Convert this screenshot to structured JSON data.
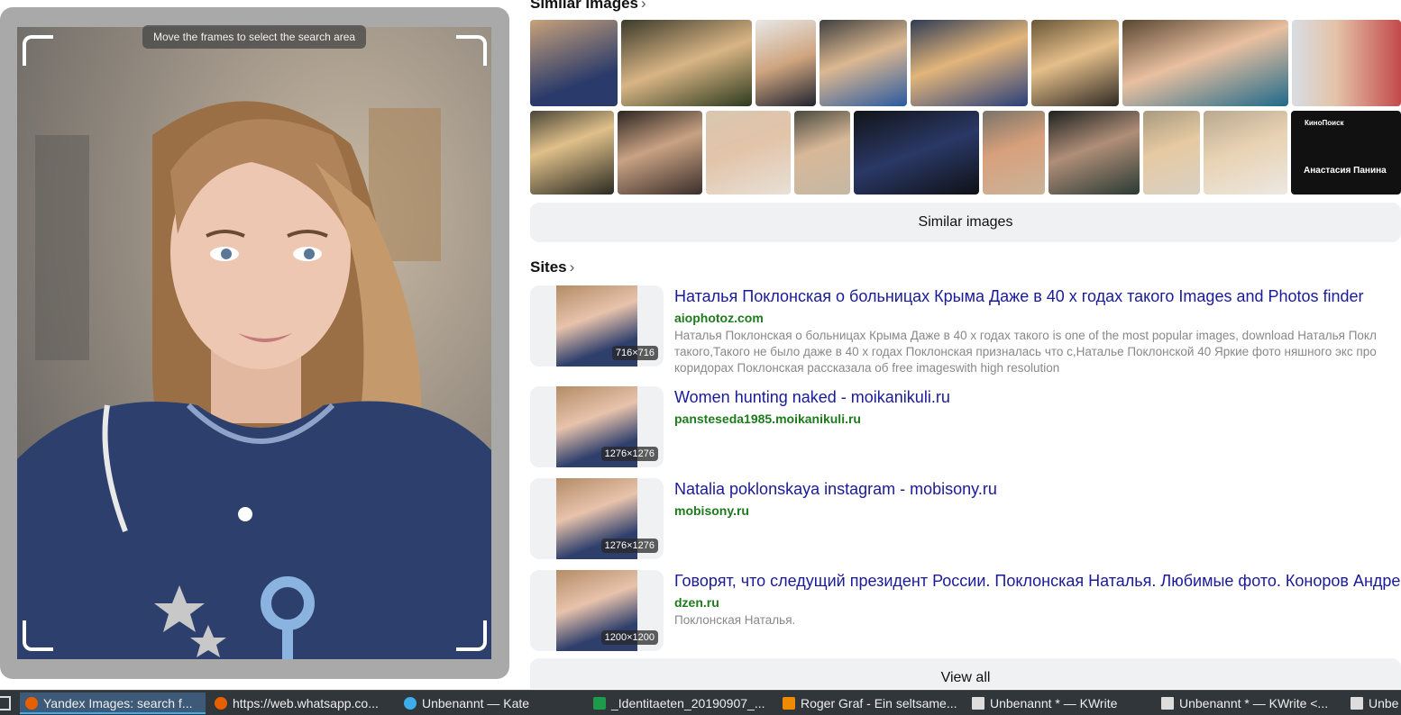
{
  "crop": {
    "hint": "Move the frames to select the search area",
    "icon_handle": "crop-handle-icon"
  },
  "similar": {
    "title": "Similar images",
    "button_label": "Similar images",
    "row1_thumbs": [
      "t1",
      "t2",
      "t3",
      "t4",
      "t5",
      "t6",
      "t7",
      "t8"
    ],
    "row2_thumbs": [
      "u1",
      "u2",
      "u3",
      "u4",
      "u5",
      "u6",
      "u7",
      "u8",
      "u9",
      "u10"
    ],
    "card_text_top": "КиноПоиск",
    "card_text_name": "Анастасия Панина"
  },
  "sites": {
    "title": "Sites",
    "view_all": "View all",
    "results": [
      {
        "title": "Наталья Поклонская о больницах Крыма Даже в 40 х годах такого Images and Photos finder",
        "site": "aiophotoz.com",
        "size": "716×716",
        "desc": [
          "Наталья Поклонская о больницах Крыма Даже в 40 х годах такого is one of the most popular images, download Наталья Покл",
          "такого,Такого не было даже в 40 х годах Поклонская призналась что с,Наталье Поклонской 40 Яркие фото няшного экс про",
          "коридорах Поклонская рассказала об free imageswith high resolution"
        ]
      },
      {
        "title": "Women hunting naked - moikanikuli.ru",
        "site": "pansteseda1985.moikanikuli.ru",
        "size": "1276×1276",
        "desc": []
      },
      {
        "title": "Natalia poklonskaya instagram - mobisony.ru",
        "site": "mobisony.ru",
        "size": "1276×1276",
        "desc": []
      },
      {
        "title": "Говорят, что следущий президент России. Поклонская Наталья. Любимые фото. Коноров Андре",
        "site": "dzen.ru",
        "size": "1200×1200",
        "desc": [
          "Поклонская Наталья."
        ]
      }
    ]
  },
  "taskbar": {
    "tasks": [
      {
        "label": "Yandex Images: search f...",
        "icon": "firefox-icon",
        "color": "#e66000"
      },
      {
        "label": "https://web.whatsapp.co...",
        "icon": "firefox-icon",
        "color": "#e66000"
      },
      {
        "label": "Unbenannt — Kate",
        "icon": "kate-icon",
        "color": "#3daee9"
      },
      {
        "label": "_Identitaeten_20190907_...",
        "icon": "spreadsheet-icon",
        "color": "#1d9a4a"
      },
      {
        "label": "Roger Graf - Ein seltsame...",
        "icon": "vlc-icon",
        "color": "#f08a00"
      },
      {
        "label": "Unbenannt * — KWrite",
        "icon": "kwrite-icon",
        "color": "#dddddd"
      },
      {
        "label": "Unbenannt * — KWrite <...",
        "icon": "kwrite-icon",
        "color": "#dddddd"
      },
      {
        "label": "Unbe",
        "icon": "kwrite-icon",
        "color": "#dddddd"
      }
    ]
  }
}
